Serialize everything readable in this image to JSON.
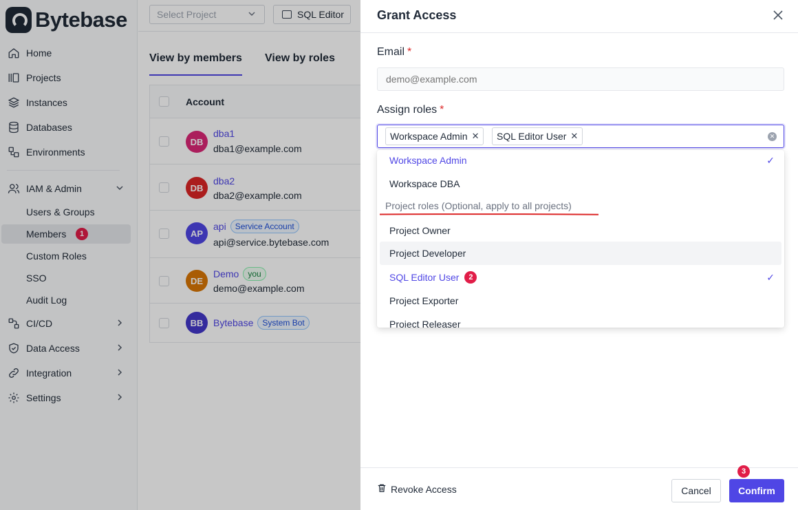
{
  "brand": {
    "name": "Bytebase"
  },
  "sidebar": {
    "items": [
      {
        "label": "Home",
        "icon": "home-icon"
      },
      {
        "label": "Projects",
        "icon": "projects-icon"
      },
      {
        "label": "Instances",
        "icon": "instances-icon"
      },
      {
        "label": "Databases",
        "icon": "databases-icon"
      },
      {
        "label": "Environments",
        "icon": "environments-icon"
      },
      {
        "label": "IAM & Admin",
        "icon": "users-icon"
      },
      {
        "label": "CI/CD",
        "icon": "cicd-icon"
      },
      {
        "label": "Data Access",
        "icon": "shield-icon"
      },
      {
        "label": "Integration",
        "icon": "link-icon"
      },
      {
        "label": "Settings",
        "icon": "gear-icon"
      }
    ],
    "iam_sub": [
      "Users & Groups",
      "Members",
      "Custom Roles",
      "SSO",
      "Audit Log"
    ],
    "members_badge": "1"
  },
  "topbar": {
    "project_placeholder": "Select Project",
    "sql_editor_label": "SQL Editor"
  },
  "tabs": [
    "View by members",
    "View by roles"
  ],
  "table": {
    "header": "Account",
    "rows": [
      {
        "initials": "DB",
        "name": "dba1",
        "email": "dba1@example.com",
        "tag": "",
        "color": "#db2777"
      },
      {
        "initials": "DB",
        "name": "dba2",
        "email": "dba2@example.com",
        "tag": "",
        "color": "#dc2626"
      },
      {
        "initials": "AP",
        "name": "api",
        "email": "api@service.bytebase.com",
        "tag": "Service Account",
        "color": "#4f46e5"
      },
      {
        "initials": "DE",
        "name": "Demo",
        "email": "demo@example.com",
        "tag": "you",
        "color": "#d97706"
      },
      {
        "initials": "BB",
        "name": "Bytebase",
        "email": "",
        "tag": "System Bot",
        "color": "#4338ca"
      }
    ]
  },
  "drawer": {
    "title": "Grant Access",
    "email_label": "Email",
    "email_placeholder": "demo@example.com",
    "roles_label": "Assign roles",
    "required_mark": "*",
    "selected_roles": [
      "Workspace Admin",
      "SQL Editor User"
    ],
    "options": [
      {
        "label": "Workspace Admin",
        "selected": true
      },
      {
        "label": "Workspace DBA",
        "selected": false
      }
    ],
    "group_label": "Project roles (Optional, apply to all projects)",
    "project_options": [
      {
        "label": "Project Owner",
        "selected": false
      },
      {
        "label": "Project Developer",
        "selected": false
      },
      {
        "label": "SQL Editor User",
        "selected": true
      },
      {
        "label": "Project Exporter",
        "selected": false
      },
      {
        "label": "Project Releaser",
        "selected": false
      }
    ],
    "sql_editor_badge": "2",
    "revoke_label": "Revoke Access",
    "cancel_label": "Cancel",
    "confirm_label": "Confirm",
    "confirm_badge": "3"
  },
  "colors": {
    "accent": "#4f46e5",
    "badge": "#e11d48",
    "underline": "#dc2626"
  }
}
